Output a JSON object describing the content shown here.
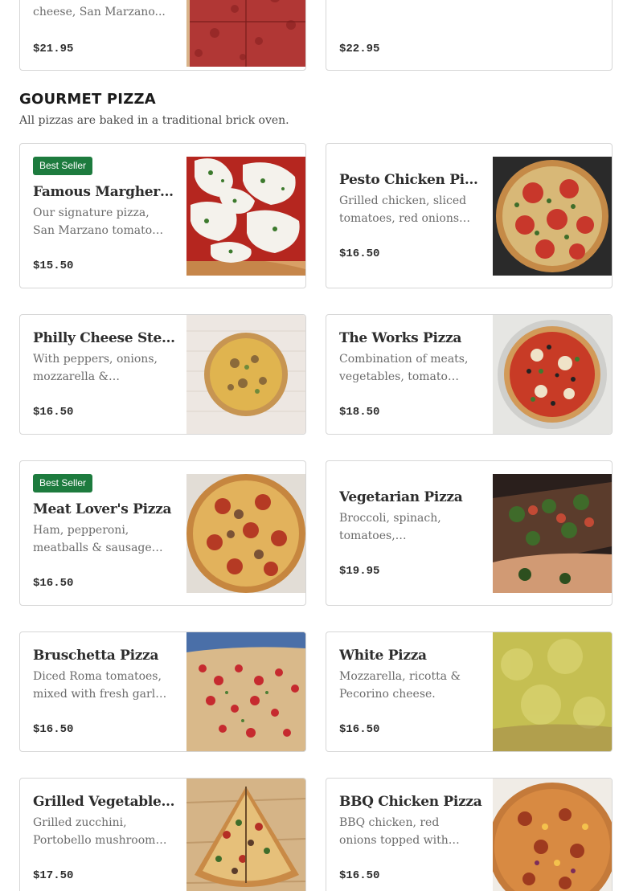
{
  "top_cards": [
    {
      "desc_fragment": "cheese, San Marzano...",
      "price": "$21.95"
    },
    {
      "desc_fragment": "",
      "price": "$22.95"
    }
  ],
  "section": {
    "title": "GOURMET PIZZA",
    "subtitle": "All pizzas are baked in a traditional brick oven."
  },
  "items": [
    {
      "badge": "Best Seller",
      "name": "Famous Margherita...",
      "description": "Our signature pizza, San Marzano tomato sauce,...",
      "price": "$15.50",
      "image": "margherita-pizza-image"
    },
    {
      "badge": "",
      "name": "Pesto Chicken Pizza",
      "description": "Grilled chicken, sliced tomatoes, red onions &...",
      "price": "$16.50",
      "image": "pesto-chicken-pizza-image"
    },
    {
      "badge": "",
      "name": "Philly Cheese Steak...",
      "description": "With peppers, onions, mozzarella & American...",
      "price": "$16.50",
      "image": "philly-cheese-steak-pizza-image"
    },
    {
      "badge": "",
      "name": "The Works Pizza",
      "description": "Combination of meats, vegetables, tomato sauce...",
      "price": "$18.50",
      "image": "works-pizza-image"
    },
    {
      "badge": "Best Seller",
      "name": "Meat Lover's Pizza",
      "description": "Ham, pepperoni, meatballs & sausage with tomato...",
      "price": "$16.50",
      "image": "meat-lovers-pizza-image"
    },
    {
      "badge": "",
      "name": "Vegetarian Pizza",
      "description": "Broccoli, spinach, tomatoes, mushrooms,...",
      "price": "$19.95",
      "image": "vegetarian-pizza-image"
    },
    {
      "badge": "",
      "name": "Bruschetta Pizza",
      "description": "Diced Roma tomatoes, mixed with fresh garlic, r...",
      "price": "$16.50",
      "image": "bruschetta-pizza-image"
    },
    {
      "badge": "",
      "name": "White Pizza",
      "description": "Mozzarella, ricotta & Pecorino cheese.",
      "price": "$16.50",
      "image": "white-pizza-image"
    },
    {
      "badge": "",
      "name": "Grilled Vegetable Pizza",
      "description": "Grilled zucchini, Portobello mushrooms, squash,...",
      "price": "$17.50",
      "image": "grilled-vegetable-pizza-image"
    },
    {
      "badge": "",
      "name": "BBQ Chicken Pizza",
      "description": "BBQ chicken, red onions topped with cheddar &...",
      "price": "$16.50",
      "image": "bbq-chicken-pizza-image"
    }
  ]
}
